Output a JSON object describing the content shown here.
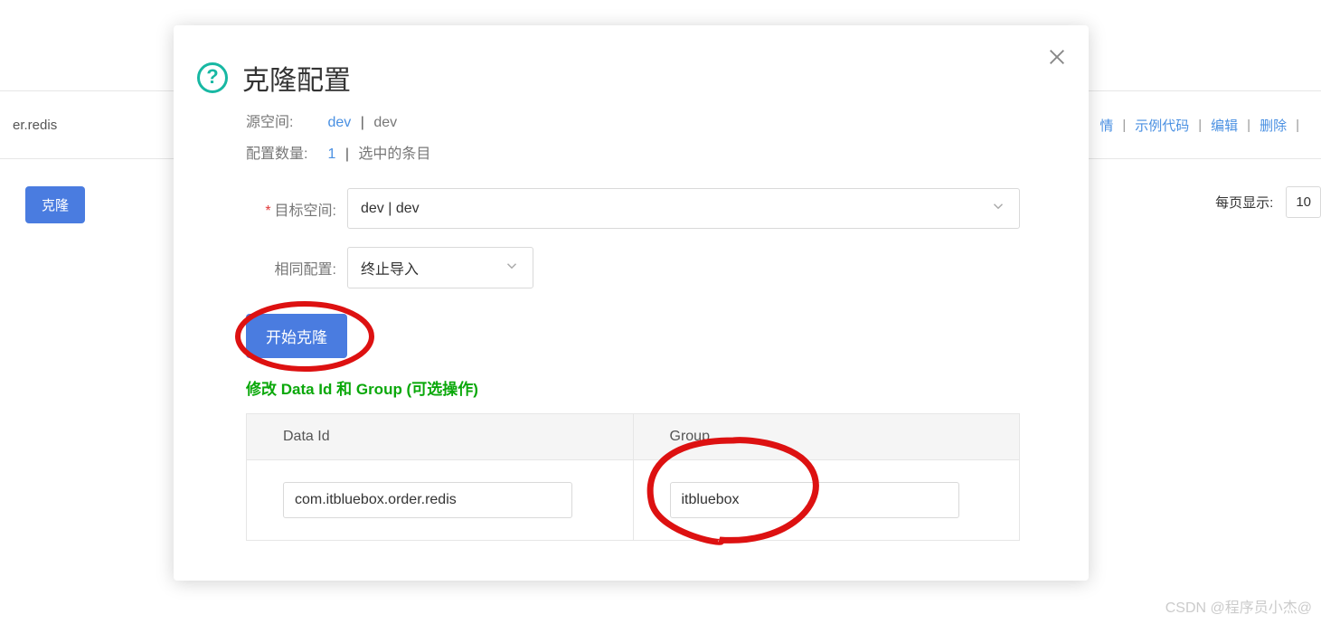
{
  "background": {
    "row_text": "er.redis",
    "actions": {
      "detail_tail": "情",
      "sample": "示例代码",
      "edit": "编辑",
      "delete": "删除"
    },
    "clone_button": "克隆",
    "page_size_label": "每页显示:",
    "page_size_value": "10"
  },
  "modal": {
    "title": "克隆配置",
    "source_space_label": "源空间:",
    "source_space_link": "dev",
    "source_space_name": "dev",
    "config_count_label": "配置数量:",
    "config_count_value": "1",
    "config_count_suffix": "选中的条目",
    "target_space_label": "目标空间:",
    "target_space_value": "dev | dev",
    "same_config_label": "相同配置:",
    "same_config_value": "终止导入",
    "start_button": "开始克隆",
    "optional_title": "修改 Data Id 和 Group (可选操作)",
    "table": {
      "header_data_id": "Data Id",
      "header_group": "Group",
      "row": {
        "data_id": "com.itbluebox.order.redis",
        "group": "itbluebox"
      }
    }
  },
  "watermark": "CSDN @程序员小杰@"
}
